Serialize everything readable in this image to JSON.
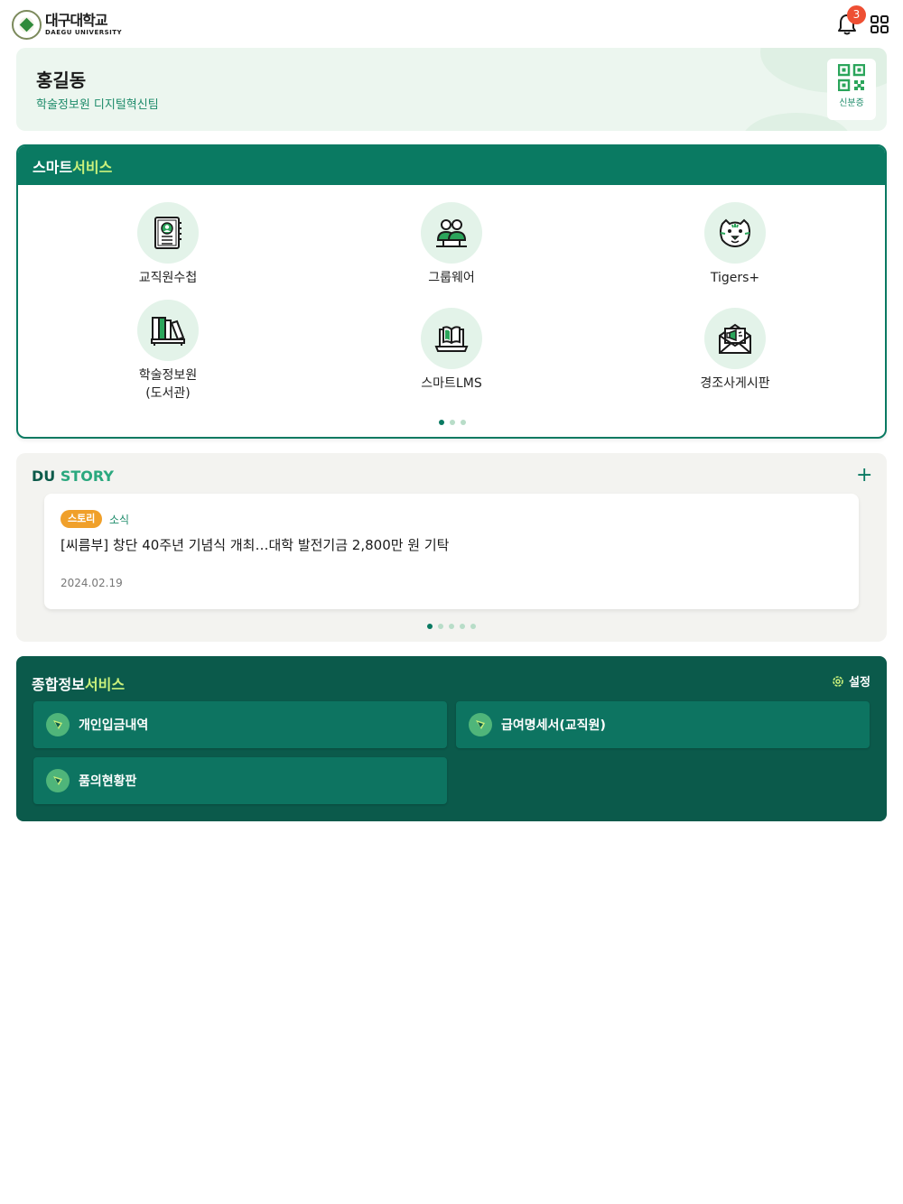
{
  "header": {
    "logo_ko": "대구대학교",
    "logo_en": "DAEGU UNIVERSITY",
    "notification_count": "3"
  },
  "profile": {
    "name": "홍길동",
    "department": "학술정보원 디지털혁신팀",
    "idcard_label": "신분증"
  },
  "smart_service": {
    "title_a": "스마트",
    "title_b": "서비스",
    "items": [
      {
        "label": "교직원수첩",
        "icon": "contact-book-icon"
      },
      {
        "label": "그룹웨어",
        "icon": "group-users-icon"
      },
      {
        "label": "Tigers+",
        "icon": "tiger-icon"
      },
      {
        "label": "학술정보원\n(도서관)",
        "label_line1": "학술정보원",
        "label_line2": "(도서관)",
        "icon": "library-books-icon"
      },
      {
        "label": "스마트LMS",
        "icon": "laptop-book-icon"
      },
      {
        "label": "경조사게시판",
        "icon": "envelope-megaphone-icon"
      }
    ],
    "page_count": 3,
    "active_page": 1
  },
  "du_story": {
    "title_a": "DU",
    "title_b": "STORY",
    "plus": "+",
    "card": {
      "badge": "스토리",
      "category": "소식",
      "headline": "[씨름부] 창단 40주년 기념식 개최…대학 발전기금 2,800만 원 기탁",
      "date": "2024.02.19"
    },
    "page_count": 5,
    "active_page": 1
  },
  "info_service": {
    "title_a": "종합정보",
    "title_b": "서비스",
    "settings_label": "설정",
    "buttons": [
      {
        "label": "개인입금내역"
      },
      {
        "label": "급여명세서(교직원)"
      },
      {
        "label": "품의현황판"
      }
    ]
  },
  "colors": {
    "primary": "#0a7a62",
    "dark_green": "#0b5a4b",
    "accent_lime": "#c9f07b",
    "badge_orange": "#f0a02a",
    "notification_red": "#ee4f33"
  }
}
